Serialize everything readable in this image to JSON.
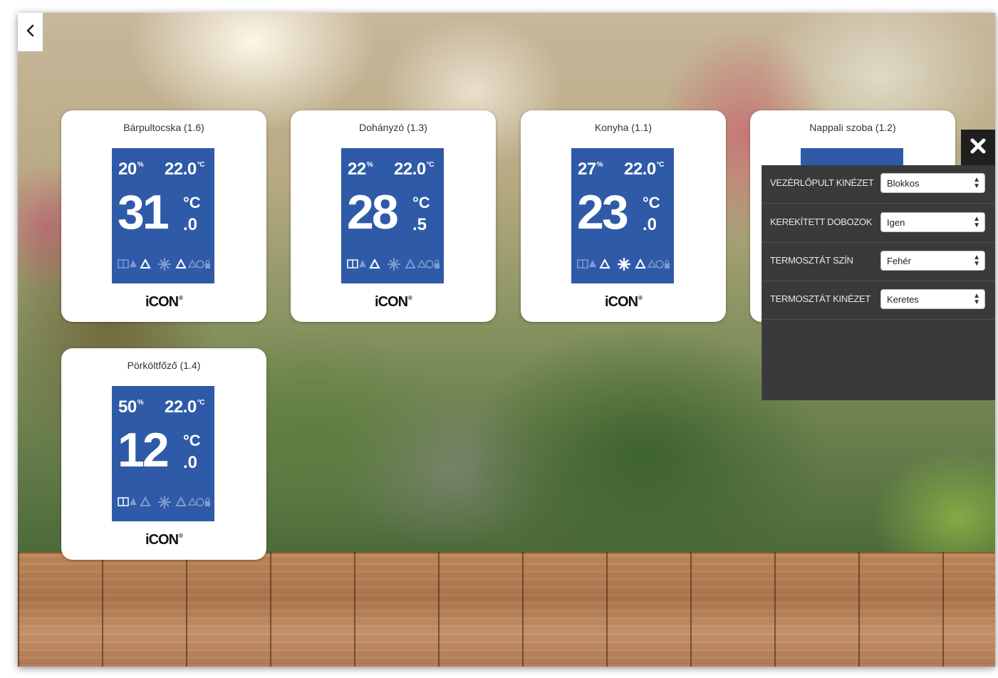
{
  "cards": [
    {
      "title": "Bárpultocska (1.6)",
      "humidity": "20",
      "humidity_unit": "%",
      "setpoint": "22.0",
      "setpoint_unit": "°C",
      "temp_int": "31",
      "temp_unit": "°C",
      "temp_dec": ".0",
      "snowflake_active": false,
      "brand": "iCON",
      "brand_mark": "®"
    },
    {
      "title": "Dohányzó (1.3)",
      "humidity": "22",
      "humidity_unit": "%",
      "setpoint": "22.0",
      "setpoint_unit": "°C",
      "temp_int": "28",
      "temp_unit": "°C",
      "temp_dec": ".5",
      "snowflake_active": false,
      "brand": "iCON",
      "brand_mark": "®"
    },
    {
      "title": "Konyha (1.1)",
      "humidity": "27",
      "humidity_unit": "%",
      "setpoint": "22.0",
      "setpoint_unit": "°C",
      "temp_int": "23",
      "temp_unit": "°C",
      "temp_dec": ".0",
      "snowflake_active": true,
      "brand": "iCON",
      "brand_mark": "®"
    },
    {
      "title": "Nappali szoba (1.2)"
    },
    {
      "title": "Pörköltfőző (1.4)",
      "humidity": "50",
      "humidity_unit": "%",
      "setpoint": "22.0",
      "setpoint_unit": "°C",
      "temp_int": "12",
      "temp_unit": "°C",
      "temp_dec": ".0",
      "snowflake_active": false,
      "brand": "iCON",
      "brand_mark": "®"
    }
  ],
  "settings": {
    "rows": [
      {
        "label": "VEZÉRLŐPULT KINÉZET",
        "value": "Blokkos"
      },
      {
        "label": "KEREKÍTETT DOBOZOK",
        "value": "Igen"
      },
      {
        "label": "TERMOSZTÁT SZÍN",
        "value": "Fehér"
      },
      {
        "label": "TERMOSZTÁT KINÉZET",
        "value": "Keretes"
      }
    ]
  },
  "icons": {
    "back": "chevron-left-icon",
    "close": "close-icon",
    "status": [
      "window-icon",
      "drop-icon",
      "warning-icon",
      "snowflake-icon",
      "warning-icon",
      "clock-icon",
      "lock-icon"
    ]
  },
  "colors": {
    "thermostat_blue": "#2f5aa8",
    "panel_dark": "#3a3a3a",
    "card_white": "#ffffff"
  }
}
